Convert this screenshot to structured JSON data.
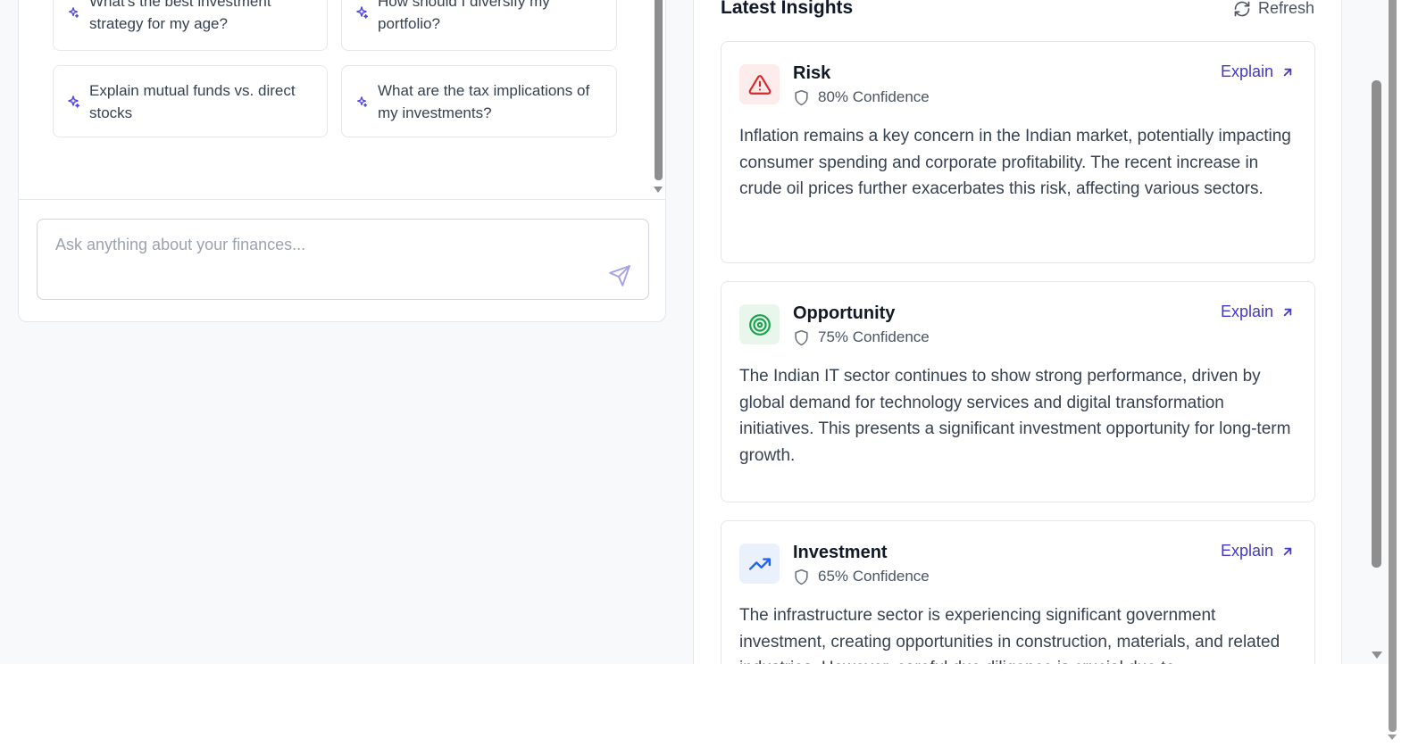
{
  "chat": {
    "suggestions": [
      "What's the best investment strategy for my age?",
      "How should I diversify my portfolio?",
      "Explain mutual funds vs. direct stocks",
      "What are the tax implications of my investments?"
    ],
    "input_placeholder": "Ask anything about your finances..."
  },
  "insights": {
    "title": "Latest Insights",
    "refresh_label": "Refresh",
    "cards": [
      {
        "type": "Risk",
        "confidence": "80% Confidence",
        "explain_label": "Explain",
        "icon": "alert-triangle-icon",
        "accent": "#dc2626",
        "body": "Inflation remains a key concern in the Indian market, potentially impacting consumer spending and corporate profitability. The recent increase in crude oil prices further exacerbates this risk, affecting various sectors."
      },
      {
        "type": "Opportunity",
        "confidence": "75% Confidence",
        "explain_label": "Explain",
        "icon": "target-icon",
        "accent": "#16a34a",
        "body": "The Indian IT sector continues to show strong performance, driven by global demand for technology services and digital transformation initiatives. This presents a significant investment opportunity for long-term growth."
      },
      {
        "type": "Investment",
        "confidence": "65% Confidence",
        "explain_label": "Explain",
        "icon": "trending-up-icon",
        "accent": "#2563eb",
        "body": "The infrastructure sector is experiencing significant government investment, creating opportunities in construction, materials, and related industries. However, careful due diligence is crucial due to"
      }
    ]
  },
  "colors": {
    "accent": "#4338ca",
    "border": "#e5e7eb",
    "background": "#f8f9fb"
  }
}
